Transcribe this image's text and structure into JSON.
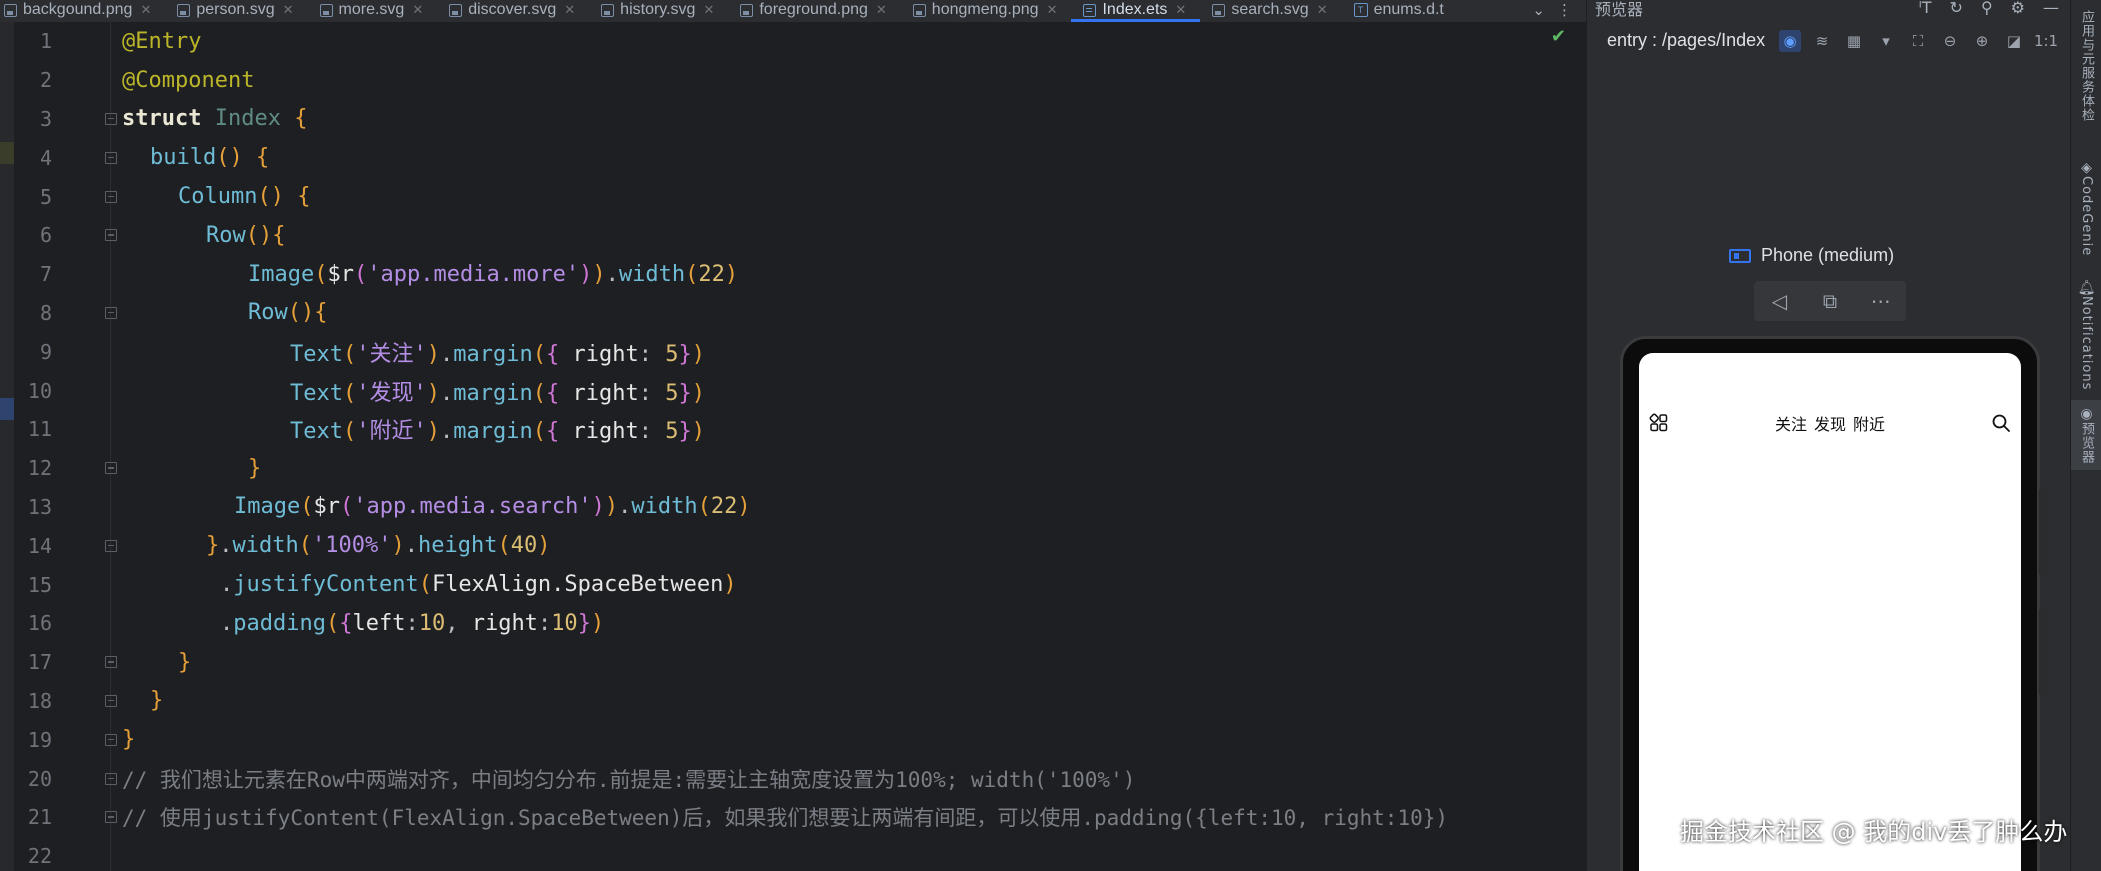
{
  "tabs": [
    {
      "label": "backgound.png",
      "icon": "image-file-icon",
      "active": false
    },
    {
      "label": "person.svg",
      "icon": "image-file-icon",
      "active": false
    },
    {
      "label": "more.svg",
      "icon": "image-file-icon",
      "active": false
    },
    {
      "label": "discover.svg",
      "icon": "image-file-icon",
      "active": false
    },
    {
      "label": "history.svg",
      "icon": "image-file-icon",
      "active": false
    },
    {
      "label": "foreground.png",
      "icon": "image-file-icon",
      "active": false
    },
    {
      "label": "hongmeng.png",
      "icon": "image-file-icon",
      "active": false
    },
    {
      "label": "Index.ets",
      "icon": "ets-file-icon",
      "active": true
    },
    {
      "label": "search.svg",
      "icon": "image-file-icon",
      "active": false
    },
    {
      "label": "enums.d.t",
      "icon": "ts-file-icon",
      "active": false
    }
  ],
  "editor": {
    "lines": [
      "1",
      "2",
      "3",
      "4",
      "5",
      "6",
      "7",
      "8",
      "9",
      "10",
      "11",
      "12",
      "13",
      "14",
      "15",
      "16",
      "17",
      "18",
      "19",
      "20",
      "21",
      "22"
    ],
    "code": {
      "l1": "@Entry",
      "l2": "@Component",
      "l3_kw": "struct",
      "l3_cls": "Index",
      "l4_fn": "build",
      "l5_fn": "Column",
      "l6_fn": "Row",
      "l7_fn": "Image",
      "l7_r": "$r",
      "l7_str": "'app.media.more'",
      "l7_m": "width",
      "l7_num": "22",
      "l8_fn": "Row",
      "l9_str": "'关注'",
      "l10_str": "'发现'",
      "l11_str": "'附近'",
      "text_fn": "Text",
      "margin_fn": "margin",
      "right_key": "right",
      "margin_num": "5",
      "l13_str": "'app.media.search'",
      "l14_width": "width",
      "l14_str": "'100%'",
      "l14_height": "height",
      "l14_num": "40",
      "l15_fn": "justifyContent",
      "l15_arg": "FlexAlign.SpaceBetween",
      "l16_fn": "padding",
      "l16_left": "left",
      "l16_num": "10",
      "l16_right": "right",
      "l20": "// 我们想让元素在Row中两端对齐，中间均匀分布.前提是:需要让主轴宽度设置为100%; width('100%')",
      "l21": "// 使用justifyContent(FlexAlign.SpaceBetween)后，如果我们想要让两端有间距，可以使用.padding({left:10, right:10})"
    }
  },
  "preview": {
    "panel_title": "预览器",
    "route": "entry : /pages/Index",
    "device_name": "Phone (medium)",
    "app_tabs": [
      "关注",
      "发现",
      "附近"
    ]
  },
  "right_strip": [
    {
      "label": "应用与元服务体检",
      "icon": "check-service-icon"
    },
    {
      "label": "CodeGenie",
      "icon": "codegenie-icon"
    },
    {
      "label": "Notifications",
      "icon": "bell-icon"
    },
    {
      "label": "预览器",
      "icon": "eye-icon"
    }
  ],
  "watermark": "掘金技术社区 @ 我的div丢了肿么办",
  "colors": {
    "editor_bg": "#1e1f22",
    "panel_bg": "#2b2d30",
    "accent": "#3574f0",
    "annotation": "#bbb529",
    "string": "#a0ce7b",
    "number": "#dbbd73",
    "comment": "#7a7e85"
  }
}
